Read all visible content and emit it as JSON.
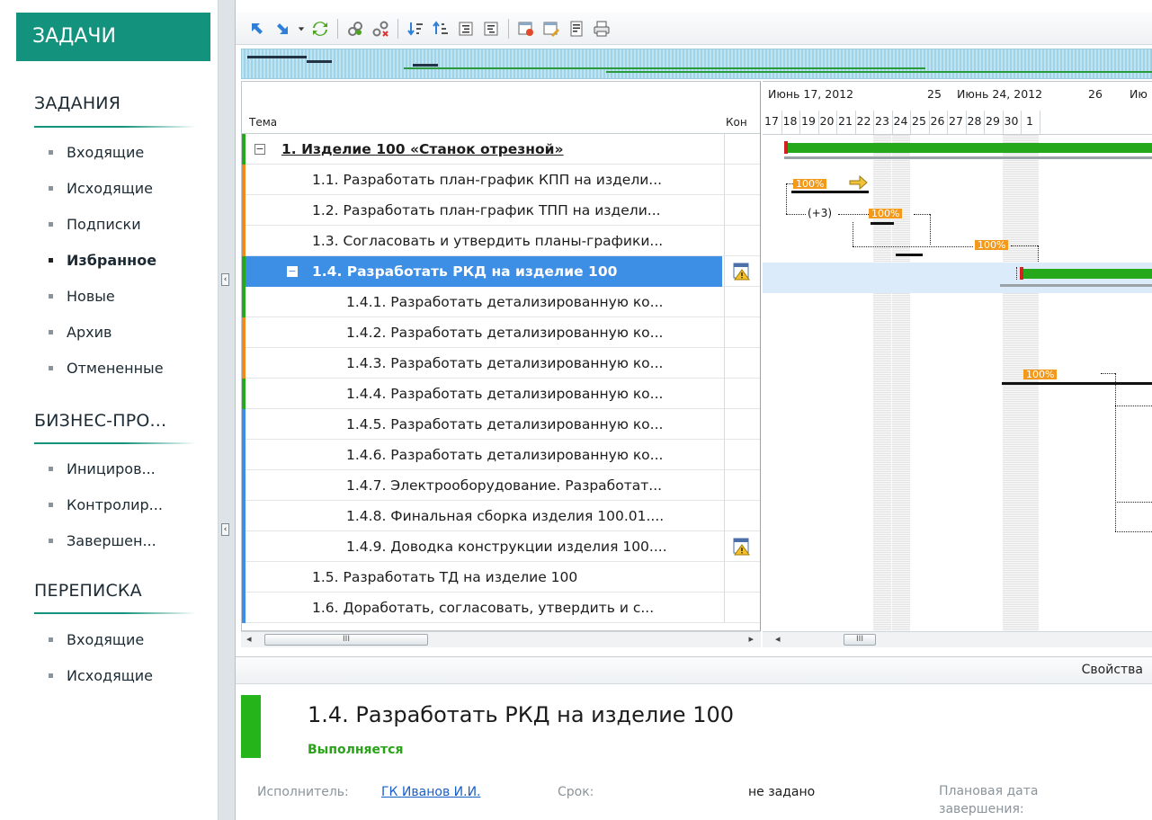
{
  "sidebar": {
    "header": "ЗАДАЧИ",
    "sections": [
      {
        "title": "ЗАДАНИЯ",
        "items": [
          "Входящие",
          "Исходящие",
          "Подписки",
          "Избранное",
          "Новые",
          "Архив",
          "Отмененные"
        ]
      },
      {
        "title": "БИЗНЕС-ПРО...",
        "items": [
          "Инициров...",
          "Контролир...",
          "Завершен..."
        ]
      },
      {
        "title": "ПЕРЕПИСКА",
        "items": [
          "Входящие",
          "Исходящие"
        ]
      }
    ],
    "active_item": "Избранное"
  },
  "toolbar": {
    "buttons": [
      "arrow-up-left-icon",
      "arrow-down-right-icon",
      "dropdown-icon",
      "refresh-icon",
      "link-icon",
      "unlink-icon",
      "sort-desc-icon",
      "sort-asc-icon",
      "indent-icon",
      "outdent-icon",
      "task-delete-icon",
      "task-edit-icon",
      "properties-icon",
      "print-icon"
    ]
  },
  "grid": {
    "columns": {
      "title": "Тема",
      "kon": "Кон"
    },
    "rows": [
      {
        "label": "1. Изделие 100 «Станок отрезной»",
        "level": 0,
        "stripe": "#25a81a",
        "toggle": "−",
        "bold": true
      },
      {
        "label": "1.1. Разработать план-график КПП на издели...",
        "level": 1,
        "stripe": "#f08a1d"
      },
      {
        "label": "1.2. Разработать план-график ТПП на издели...",
        "level": 1,
        "stripe": "#f08a1d"
      },
      {
        "label": "1.3. Согласовать и утвердить планы-графики...",
        "level": 1,
        "stripe": "#f08a1d"
      },
      {
        "label": "1.4. Разработать РКД на изделие 100",
        "level": 1,
        "stripe": "#25a81a",
        "toggle": "−",
        "selected": true,
        "icon": "warning-calendar-icon"
      },
      {
        "label": "1.4.1. Разработать детализированную ко...",
        "level": 2,
        "stripe": "#25a81a"
      },
      {
        "label": "1.4.2. Разработать детализированную ко...",
        "level": 2,
        "stripe": "#f08a1d"
      },
      {
        "label": "1.4.3. Разработать детализированную ко...",
        "level": 2,
        "stripe": "#f08a1d"
      },
      {
        "label": "1.4.4. Разработать детализированную ко...",
        "level": 2,
        "stripe": "#25a81a"
      },
      {
        "label": "1.4.5. Разработать детализированную ко...",
        "level": 2,
        "stripe": "#3d8fe5"
      },
      {
        "label": "1.4.6. Разработать детализированную ко...",
        "level": 2,
        "stripe": "#3d8fe5"
      },
      {
        "label": "1.4.7. Электрооборудование. Разработат...",
        "level": 2,
        "stripe": "#3d8fe5"
      },
      {
        "label": "1.4.8. Финальная сборка изделия 100.01....",
        "level": 2,
        "stripe": "#3d8fe5"
      },
      {
        "label": "1.4.9. Доводка конструкции изделия 100....",
        "level": 2,
        "stripe": "#3d8fe5",
        "icon": "warning-calendar-icon"
      },
      {
        "label": "1.5. Разработать ТД на изделие 100",
        "level": 1,
        "stripe": "#3d8fe5"
      },
      {
        "label": "1.6. Доработать, согласовать, утвердить и с...",
        "level": 1,
        "stripe": "#3d8fe5"
      }
    ],
    "scroll_thumb": "III"
  },
  "gantt": {
    "weeks": [
      {
        "label": "Июнь 17, 2012"
      },
      {
        "label": "25"
      },
      {
        "label": "Июнь 24, 2012"
      },
      {
        "label": "26"
      },
      {
        "label": "Ию"
      }
    ],
    "days": [
      "17",
      "18",
      "19",
      "20",
      "21",
      "22",
      "23",
      "24",
      "25",
      "26",
      "27",
      "28",
      "29",
      "30",
      "1"
    ],
    "weekend_days": [
      "23",
      "24",
      "30",
      "1"
    ],
    "percent_labels": [
      "100%",
      "100%",
      "100%",
      "100%"
    ],
    "lag_label": "(+3)",
    "scroll_thumb": "III"
  },
  "properties": {
    "tab_label": "Свойства",
    "title": "1.4. Разработать РКД на изделие 100",
    "status": "Выполняется",
    "status_color": "#2aa21a",
    "executor_label": "Исполнитель:",
    "executor_value": "ГК Иванов И.И.",
    "deadline_label": "Срок:",
    "deadline_value": "не задано",
    "planned_label": "Плановая дата завершения:"
  },
  "colors": {
    "accent": "#13927e",
    "selection": "#3d8fe5",
    "progress": "#25a81a",
    "percent": "#f39a1d"
  }
}
